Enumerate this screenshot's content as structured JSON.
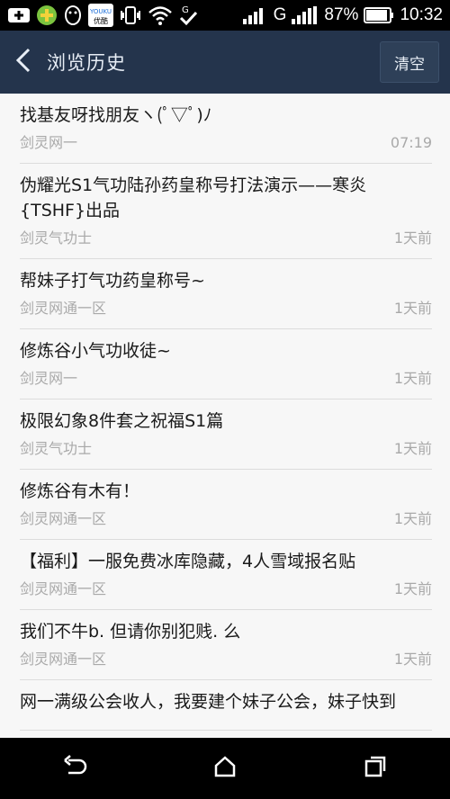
{
  "status_bar": {
    "battery": "87%",
    "time": "10:32",
    "network_label": "G",
    "app_icon_text": "YOUKU",
    "app_icon_sub": "优酷"
  },
  "header": {
    "title": "浏览历史",
    "clear_label": "清空",
    "bg_color": "#24344c"
  },
  "history": [
    {
      "title": "找基友呀找朋友ヽ(ﾟ▽ﾟ)ﾉ",
      "source": "剑灵网一",
      "time": "07:19"
    },
    {
      "title": "伪耀光S1气功陆孙药皇称号打法演示——寒炎{TSHF}出品",
      "source": "剑灵气功士",
      "time": "1天前"
    },
    {
      "title": "帮妹子打气功药皇称号~",
      "source": "剑灵网通一区",
      "time": "1天前"
    },
    {
      "title": "修炼谷小气功收徒~",
      "source": "剑灵网一",
      "time": "1天前"
    },
    {
      "title": "极限幻象8件套之祝福S1篇",
      "source": "剑灵气功士",
      "time": "1天前"
    },
    {
      "title": "修炼谷有木有！",
      "source": "剑灵网通一区",
      "time": "1天前"
    },
    {
      "title": "【福利】一服免费冰库隐藏，4人雪域报名贴",
      "source": "剑灵网通一区",
      "time": "1天前"
    },
    {
      "title": "我们不牛b. 但请你别犯贱. 么",
      "source": "剑灵网通一区",
      "time": "1天前"
    },
    {
      "title": "网一满级公会收人，我要建个妹子公会，妹子快到",
      "source": "",
      "time": ""
    }
  ]
}
